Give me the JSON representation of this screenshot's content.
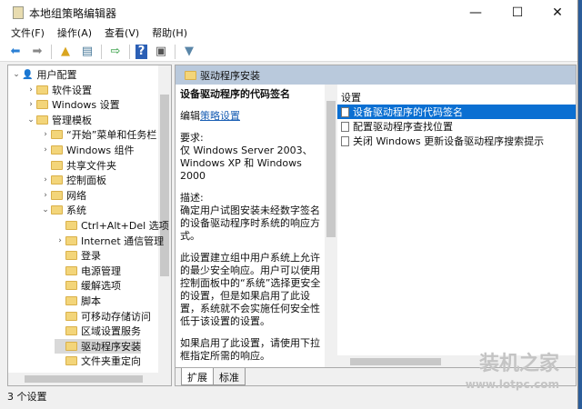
{
  "window": {
    "title": "本地组策略编辑器"
  },
  "menu": [
    "文件(F)",
    "操作(A)",
    "查看(V)",
    "帮助(H)"
  ],
  "tree": [
    {
      "label": "用户配置",
      "level": 0,
      "arrow": "expanded"
    },
    {
      "label": "软件设置",
      "level": 1,
      "arrow": "collapsed"
    },
    {
      "label": "Windows 设置",
      "level": 1,
      "arrow": "collapsed"
    },
    {
      "label": "管理模板",
      "level": 1,
      "arrow": "expanded"
    },
    {
      "label": "“开始”菜单和任务栏",
      "level": 2,
      "arrow": "collapsed"
    },
    {
      "label": "Windows 组件",
      "level": 2,
      "arrow": "collapsed"
    },
    {
      "label": "共享文件夹",
      "level": 2,
      "arrow": "none"
    },
    {
      "label": "控制面板",
      "level": 2,
      "arrow": "collapsed"
    },
    {
      "label": "网络",
      "level": 2,
      "arrow": "collapsed"
    },
    {
      "label": "系统",
      "level": 2,
      "arrow": "expanded"
    },
    {
      "label": "Ctrl+Alt+Del 选项",
      "level": 3,
      "arrow": "none"
    },
    {
      "label": "Internet 通信管理",
      "level": 3,
      "arrow": "collapsed"
    },
    {
      "label": "登录",
      "level": 3,
      "arrow": "none"
    },
    {
      "label": "电源管理",
      "level": 3,
      "arrow": "none"
    },
    {
      "label": "缓解选项",
      "level": 3,
      "arrow": "none"
    },
    {
      "label": "脚本",
      "level": 3,
      "arrow": "none"
    },
    {
      "label": "可移动存储访问",
      "level": 3,
      "arrow": "none"
    },
    {
      "label": "区域设置服务",
      "level": 3,
      "arrow": "none"
    },
    {
      "label": "驱动程序安装",
      "level": 3,
      "arrow": "none",
      "selected": true
    },
    {
      "label": "文件夹重定向",
      "level": 3,
      "arrow": "none"
    }
  ],
  "panel": {
    "header": "驱动程序安装"
  },
  "desc": {
    "title": "设备驱动程序的代码签名",
    "edit_prefix": "编辑",
    "edit_link": "策略设置",
    "req_label": "要求:",
    "req_text": "仅 Windows Server 2003、Windows XP 和 Windows 2000",
    "desc_label": "描述:",
    "desc_text": "确定用户试图安装未经数字签名的设备驱动程序时系统的响应方式。",
    "para2": "此设置建立组中用户系统上允许的最少安全响应。用户可以使用控制面板中的“系统”选择更安全的设置，但是如果启用了此设置，系统就不会实施任何安全性低于该设置的设置。",
    "para3": "如果启用了此设置，请使用下拉框指定所需的响应。"
  },
  "list": {
    "header": "设置",
    "items": [
      "设备驱动程序的代码签名",
      "配置驱动程序查找位置",
      "关闭 Windows 更新设备驱动程序搜索提示"
    ]
  },
  "tabs": [
    "扩展",
    "标准"
  ],
  "status": "3 个设置",
  "watermark": {
    "name": "装机之家",
    "url": "www.lotpc.com"
  }
}
